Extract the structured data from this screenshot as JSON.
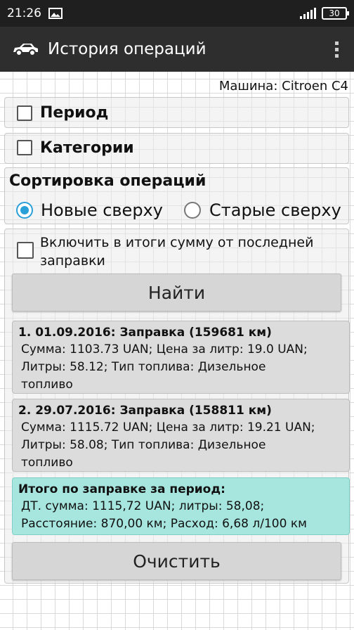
{
  "status_bar": {
    "time": "21:26",
    "battery": "30",
    "icons": [
      "image-icon",
      "signal-icon",
      "battery-icon"
    ]
  },
  "action_bar": {
    "title": "История операций",
    "icon": "car-icon",
    "menu_icon": "overflow-menu-icon"
  },
  "machine_label": "Машина: Citroen C4",
  "filters": {
    "period_label": "Период",
    "period_checked": false,
    "category_label": "Категории",
    "category_checked": false
  },
  "sorting": {
    "title": "Сортировка операций",
    "options": [
      {
        "label": "Новые сверху",
        "selected": true
      },
      {
        "label": "Старые сверху",
        "selected": false
      }
    ]
  },
  "include_last": {
    "label_line1": "Включить в итоги сумму от последней",
    "label_line2": "заправки",
    "checked": false
  },
  "find_button": "Найти",
  "operations": [
    {
      "title": "1. 01.09.2016: Заправка (159681 км)",
      "line1": "Сумма: 1103.73 UAN; Цена за литр: 19.0 UAN;",
      "line2": "Литры: 58.12; Тип топлива: Дизельное",
      "line3": "топливо"
    },
    {
      "title": "2. 29.07.2016: Заправка (158811 км)",
      "line1": "Сумма: 1115.72 UAN; Цена за литр: 19.21 UAN;",
      "line2": "Литры: 58.08; Тип топлива: Дизельное",
      "line3": "топливо"
    }
  ],
  "total": {
    "title": "Итого по заправке за период:",
    "line1": "ДТ. сумма: 1115,72 UAN; литры: 58,08;",
    "line2": "Расстояние: 870,00 км; Расход: 6,68 л/100 км"
  },
  "clear_button": "Очистить",
  "colors": {
    "accent": "#2aa0d8",
    "total_bg": "#a6e6de",
    "actionbar_bg": "#2e2e2e"
  }
}
